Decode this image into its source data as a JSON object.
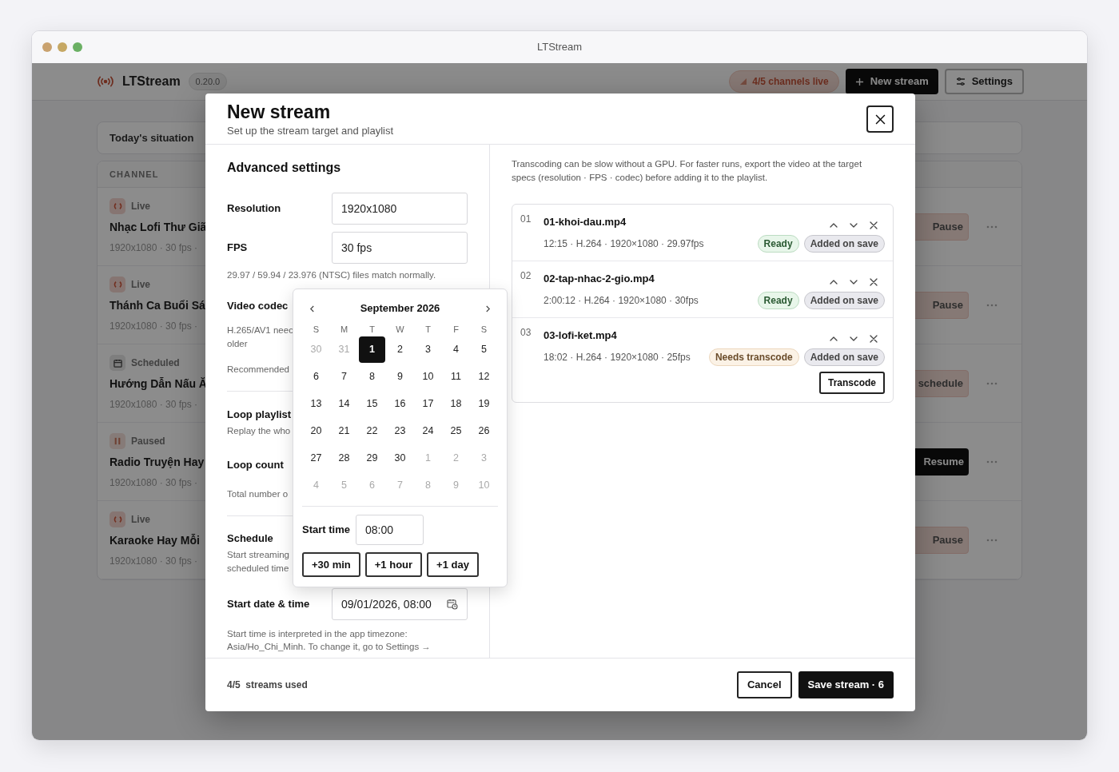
{
  "window": {
    "title": "LTStream"
  },
  "app": {
    "name": "LTStream",
    "version": "0.20.0",
    "live_pill": "4/5 channels live",
    "new_button": "New stream",
    "settings_button": "Settings",
    "today_title": "Today's situation",
    "channel_header": "CHANNEL",
    "channels": [
      {
        "status": "Live",
        "kind": "live",
        "name": "Nhạc Lofi Thư Giã",
        "meta": "1920x1080 · 30 fps ·",
        "action": {
          "label": "Pause",
          "kind": "pause"
        }
      },
      {
        "status": "Live",
        "kind": "live",
        "name": "Thánh Ca Buổi Sá",
        "meta": "1920x1080 · 30 fps ·",
        "action": {
          "label": "Pause",
          "kind": "pause"
        }
      },
      {
        "status": "Scheduled",
        "kind": "scheduled",
        "name": "Hướng Dẫn Nấu Ă",
        "meta": "1920x1080 · 30 fps ·",
        "action": {
          "label": "schedule",
          "kind": "schedule"
        }
      },
      {
        "status": "Paused",
        "kind": "paused",
        "name": "Radio Truyện Hay",
        "meta": "1920x1080 · 30 fps ·",
        "action": {
          "label": "Resume",
          "kind": "resume"
        }
      },
      {
        "status": "Live",
        "kind": "live",
        "name": "Karaoke Hay Mỗi",
        "meta": "1920x1080 · 30 fps ·",
        "action": {
          "label": "Pause",
          "kind": "pause"
        }
      }
    ]
  },
  "modal": {
    "title": "New stream",
    "subtitle": "Set up the stream target and playlist",
    "advanced": {
      "heading": "Advanced settings",
      "resolution_label": "Resolution",
      "resolution": "1920x1080",
      "fps_label": "FPS",
      "fps": "30 fps",
      "fps_hint": "29.97 / 59.94 / 23.976 (NTSC) files match normally.",
      "codec_label": "Video codec",
      "codec_hint": "H.265/AV1 neec\nolder",
      "codec_recommended": "Recommended",
      "loop_label": "Loop playlist",
      "loop_hint": "Replay the who",
      "loop_count_label": "Loop count",
      "loop_count_hint": "Total number o",
      "schedule_label": "Schedule",
      "schedule_hint": "Start streaming\nscheduled time",
      "start_label": "Start date & time",
      "start_value": "09/01/2026, 08:00",
      "timezone_hint": "Start time is interpreted in the app timezone: Asia/Ho_Chi_Minh. To change it, go to Settings →"
    },
    "calendar": {
      "month": "September 2026",
      "weekdays": [
        "S",
        "M",
        "T",
        "W",
        "T",
        "F",
        "S"
      ],
      "weeks": [
        [
          {
            "day": "30",
            "muted": true,
            "selected": false
          },
          {
            "day": "31",
            "muted": true,
            "selected": false
          },
          {
            "day": "1",
            "muted": false,
            "selected": true
          },
          {
            "day": "2",
            "muted": false,
            "selected": false
          },
          {
            "day": "3",
            "muted": false,
            "selected": false
          },
          {
            "day": "4",
            "muted": false,
            "selected": false
          },
          {
            "day": "5",
            "muted": false,
            "selected": false
          }
        ],
        [
          {
            "day": "6",
            "muted": false,
            "selected": false
          },
          {
            "day": "7",
            "muted": false,
            "selected": false
          },
          {
            "day": "8",
            "muted": false,
            "selected": false
          },
          {
            "day": "9",
            "muted": false,
            "selected": false
          },
          {
            "day": "10",
            "muted": false,
            "selected": false
          },
          {
            "day": "11",
            "muted": false,
            "selected": false
          },
          {
            "day": "12",
            "muted": false,
            "selected": false
          }
        ],
        [
          {
            "day": "13",
            "muted": false,
            "selected": false
          },
          {
            "day": "14",
            "muted": false,
            "selected": false
          },
          {
            "day": "15",
            "muted": false,
            "selected": false
          },
          {
            "day": "16",
            "muted": false,
            "selected": false
          },
          {
            "day": "17",
            "muted": false,
            "selected": false
          },
          {
            "day": "18",
            "muted": false,
            "selected": false
          },
          {
            "day": "19",
            "muted": false,
            "selected": false
          }
        ],
        [
          {
            "day": "20",
            "muted": false,
            "selected": false
          },
          {
            "day": "21",
            "muted": false,
            "selected": false
          },
          {
            "day": "22",
            "muted": false,
            "selected": false
          },
          {
            "day": "23",
            "muted": false,
            "selected": false
          },
          {
            "day": "24",
            "muted": false,
            "selected": false
          },
          {
            "day": "25",
            "muted": false,
            "selected": false
          },
          {
            "day": "26",
            "muted": false,
            "selected": false
          }
        ],
        [
          {
            "day": "27",
            "muted": false,
            "selected": false
          },
          {
            "day": "28",
            "muted": false,
            "selected": false
          },
          {
            "day": "29",
            "muted": false,
            "selected": false
          },
          {
            "day": "30",
            "muted": false,
            "selected": false
          },
          {
            "day": "1",
            "muted": true,
            "selected": false
          },
          {
            "day": "2",
            "muted": true,
            "selected": false
          },
          {
            "day": "3",
            "muted": true,
            "selected": false
          }
        ],
        [
          {
            "day": "4",
            "muted": true,
            "selected": false
          },
          {
            "day": "5",
            "muted": true,
            "selected": false
          },
          {
            "day": "6",
            "muted": true,
            "selected": false
          },
          {
            "day": "7",
            "muted": true,
            "selected": false
          },
          {
            "day": "8",
            "muted": true,
            "selected": false
          },
          {
            "day": "9",
            "muted": true,
            "selected": false
          },
          {
            "day": "10",
            "muted": true,
            "selected": false
          }
        ]
      ],
      "time_label": "Start time",
      "time_value": "08:00",
      "quick": [
        "+30 min",
        "+1 hour",
        "+1 day"
      ]
    },
    "note": "Transcoding can be slow without a GPU. For faster runs, export the video at the target specs (resolution · FPS · codec) before adding it to the playlist.",
    "playlist": [
      {
        "index": "01",
        "name": "01-khoi-dau.mp4",
        "meta": "12:15 · H.264 · 1920×1080 · 29.97fps",
        "badges": [
          {
            "label": "Ready",
            "kind": "ready"
          },
          {
            "label": "Added on save",
            "kind": "added"
          }
        ]
      },
      {
        "index": "02",
        "name": "02-tap-nhac-2-gio.mp4",
        "meta": "2:00:12 · H.264 · 1920×1080 · 30fps",
        "badges": [
          {
            "label": "Ready",
            "kind": "ready"
          },
          {
            "label": "Added on save",
            "kind": "added"
          }
        ]
      },
      {
        "index": "03",
        "name": "03-lofi-ket.mp4",
        "meta": "18:02 · H.264 · 1920×1080 · 25fps",
        "badges": [
          {
            "label": "Needs transcode",
            "kind": "transcode"
          },
          {
            "label": "Added on save",
            "kind": "added"
          }
        ],
        "action": "Transcode"
      }
    ],
    "usage": "4/5  streams used",
    "cancel": "Cancel",
    "save": "Save stream · 6"
  }
}
